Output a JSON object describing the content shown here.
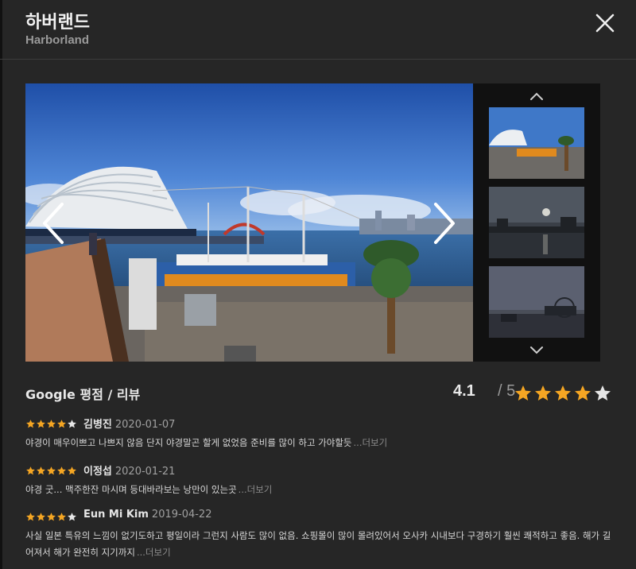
{
  "header": {
    "title": "하버랜드",
    "subtitle": "Harborland"
  },
  "gallery": {
    "thumbnail_count": 3
  },
  "rating": {
    "title": "Google 평점 / 리뷰",
    "score": "4.1",
    "separator": "/",
    "max": "5",
    "stars_filled": 4,
    "star_color": "#f5a623",
    "empty_star_color": "#e6e6e6"
  },
  "reviews": [
    {
      "author": "김병진",
      "date": "2020-01-07",
      "stars": 4,
      "text": "야경이 매우이쁘고 나쁘지 않음 단지 야경말곤 할게 없었음 준비를 많이 하고 가야할듯",
      "more": "...더보기"
    },
    {
      "author": "이정섭",
      "date": "2020-01-21",
      "stars": 5,
      "text": "야경 굿... 맥주한잔 마시며 등대바라보는 낭만이 있는곳",
      "more": "...더보기"
    },
    {
      "author": "Eun Mi Kim",
      "date": "2019-04-22",
      "stars": 4,
      "text": "사실 일본 특유의 느낌이 없기도하고 평일이라 그런지 사람도 많이 없음. 쇼핑몰이 많이 몰려있어서 오사카 시내보다 구경하기 훨씬 쾌적하고 좋음. 해가 길어져서 해가 완전히 지기까지",
      "more": "...더보기"
    }
  ]
}
